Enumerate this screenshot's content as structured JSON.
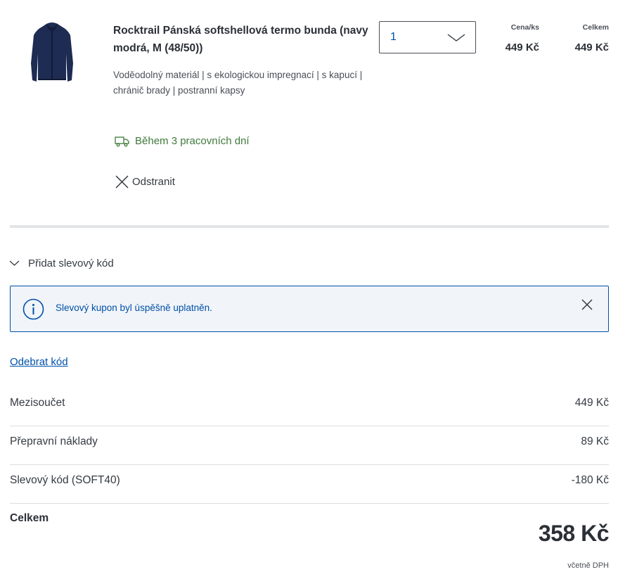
{
  "product": {
    "title": "Rocktrail Pánská softshellová termo bunda (navy modrá, M (48/50))",
    "description": "Voděodolný materiál | s ekologickou impregnací | s kapucí | chránič brady | postranní kapsy",
    "image_icon": "jacket-icon",
    "quantity": "1",
    "unit_price_label": "Cena/ks",
    "unit_price": "449 Kč",
    "total_label": "Celkem",
    "total_price": "449 Kč",
    "delivery": "Během 3 pracovních dní",
    "remove_label": "Odstranit"
  },
  "coupon": {
    "toggle_label": "Přidat slevový kód",
    "success_message": "Slevový kupon byl úspěšně uplatněn.",
    "remove_code_label": "Odebrat kód"
  },
  "summary": {
    "rows": [
      {
        "label": "Mezisoučet",
        "value": "449 Kč"
      },
      {
        "label": "Přepravní náklady",
        "value": "89 Kč"
      },
      {
        "label": "Slevový kód (SOFT40)",
        "value": "-180 Kč"
      }
    ],
    "total_label": "Celkem",
    "total_value": "358 Kč",
    "vat_note": "včetně DPH"
  },
  "colors": {
    "accent_blue": "#0050aa",
    "delivery_green": "#3f7a3b",
    "info_bg": "#f1f4f8",
    "jacket_navy": "#1e2b52"
  }
}
